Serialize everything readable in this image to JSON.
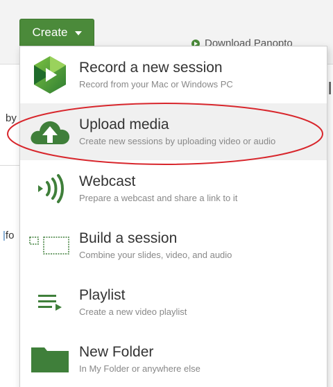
{
  "toolbar": {
    "create_label": "Create",
    "download_label": "Download Panopto"
  },
  "background": {
    "frag_by": "by",
    "frag_fo": "fo"
  },
  "menu": {
    "items": [
      {
        "title": "Record a new session",
        "subtitle": "Record from your Mac or Windows PC",
        "icon": "panopto-record-icon"
      },
      {
        "title": "Upload media",
        "subtitle": "Create new sessions by uploading video or audio",
        "icon": "cloud-upload-icon"
      },
      {
        "title": "Webcast",
        "subtitle": "Prepare a webcast and share a link to it",
        "icon": "webcast-icon"
      },
      {
        "title": "Build a session",
        "subtitle": "Combine your slides, video, and audio",
        "icon": "build-session-icon"
      },
      {
        "title": "Playlist",
        "subtitle": "Create a new video playlist",
        "icon": "playlist-icon"
      },
      {
        "title": "New Folder",
        "subtitle": "In My Folder or anywhere else",
        "icon": "folder-icon"
      }
    ],
    "highlighted_item": "Upload media"
  },
  "colors": {
    "brand_green": "#4b8a3a",
    "icon_green": "#3f7f3a",
    "highlight_red": "#d8262c"
  }
}
